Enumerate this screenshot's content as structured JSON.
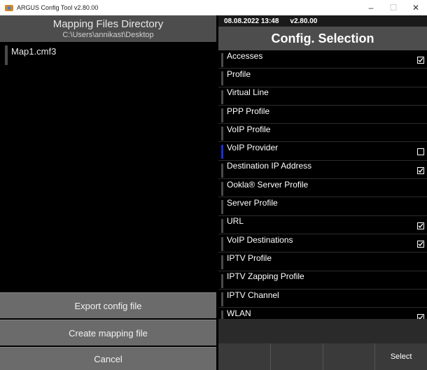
{
  "window": {
    "title": "ARGUS Config Tool v2.80.00"
  },
  "left": {
    "header_title": "Mapping Files Directory",
    "header_path": "C:\\Users\\annikast\\Desktop",
    "files": [
      "Map1.cmf3"
    ],
    "buttons": {
      "export": "Export config file",
      "create": "Create mapping file",
      "cancel": "Cancel"
    }
  },
  "right": {
    "datetime": "08.08.2022 13:48",
    "version": "v2.80.00",
    "header_title": "Config. Selection",
    "items": [
      {
        "label": "Accesses",
        "checked": true
      },
      {
        "label": "Profile",
        "checked": null
      },
      {
        "label": "Virtual Line",
        "checked": null
      },
      {
        "label": "PPP Profile",
        "checked": null
      },
      {
        "label": "VoIP Profile",
        "checked": null
      },
      {
        "label": "VoIP Provider",
        "checked": false
      },
      {
        "label": "Destination IP Address",
        "checked": true
      },
      {
        "label": "Ookla® Server Profile",
        "checked": null
      },
      {
        "label": "Server Profile",
        "checked": null
      },
      {
        "label": "URL",
        "checked": true
      },
      {
        "label": "VoIP Destinations",
        "checked": true
      },
      {
        "label": "IPTV Profile",
        "checked": null
      },
      {
        "label": "IPTV Zapping Profile",
        "checked": null
      },
      {
        "label": "IPTV Channel",
        "checked": null
      },
      {
        "label": "WLAN",
        "checked": true
      }
    ],
    "bottom_buttons": [
      "",
      "",
      "",
      "Select"
    ]
  },
  "colors": {
    "selected_marker": "#1b2fd6",
    "panel_header": "#4d4d4d",
    "button_bg": "#6b6b6b"
  }
}
